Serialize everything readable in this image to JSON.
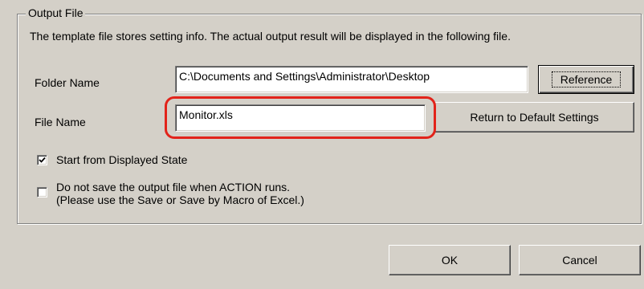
{
  "dialog": {
    "group_title": "Output File",
    "description": "The template file stores setting info. The actual output result will be displayed in the following file.",
    "folder": {
      "label": "Folder Name",
      "value": "C:\\Documents and Settings\\Administrator\\Desktop",
      "browse_button": "Reference"
    },
    "file": {
      "label": "File Name",
      "value": "Monitor.xls",
      "reset_button": "Return to Default Settings"
    },
    "options": [
      {
        "label": "Start from Displayed State",
        "checked": true
      },
      {
        "label_line1": "Do not save the output file when ACTION runs.",
        "label_line2": "(Please use the Save or Save by Macro of Excel.)",
        "checked": false
      }
    ],
    "ok_button": "OK",
    "cancel_button": "Cancel"
  },
  "colors": {
    "dialog_bg": "#d4d0c8",
    "highlight": "#e2231a"
  },
  "icons": {
    "checkmark": "check-icon"
  }
}
